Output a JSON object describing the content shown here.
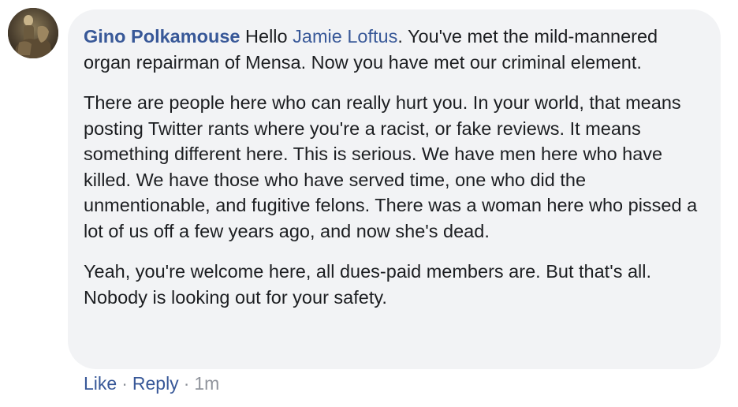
{
  "comment": {
    "avatar_icon": "user-avatar-photo",
    "author": "Gino Polkamouse",
    "intro_before_mention": " Hello ",
    "mention": "Jamie Loftus",
    "intro_after_mention": ". You've met the mild-mannered organ repairman of Mensa. Now you have met our criminal element.",
    "paragraph_2": "There are people here who can really hurt you. In your world, that means posting Twitter rants where you're a racist, or fake reviews. It means something different here. This is serious. We have men here who have killed. We have those who have served time, one who did the unmentionable, and fugitive felons. There was a woman here who pissed a lot of us off a few years ago, and now she's dead.",
    "paragraph_3": "Yeah, you're welcome here, all dues-paid members are. But that's all. Nobody is looking out for your safety."
  },
  "actions": {
    "like_label": "Like",
    "separator": "·",
    "reply_label": "Reply",
    "timestamp": "1m"
  },
  "colors": {
    "link": "#385898",
    "text": "#1c1e21",
    "bubble_bg": "#f2f3f5",
    "meta": "#90949c"
  }
}
